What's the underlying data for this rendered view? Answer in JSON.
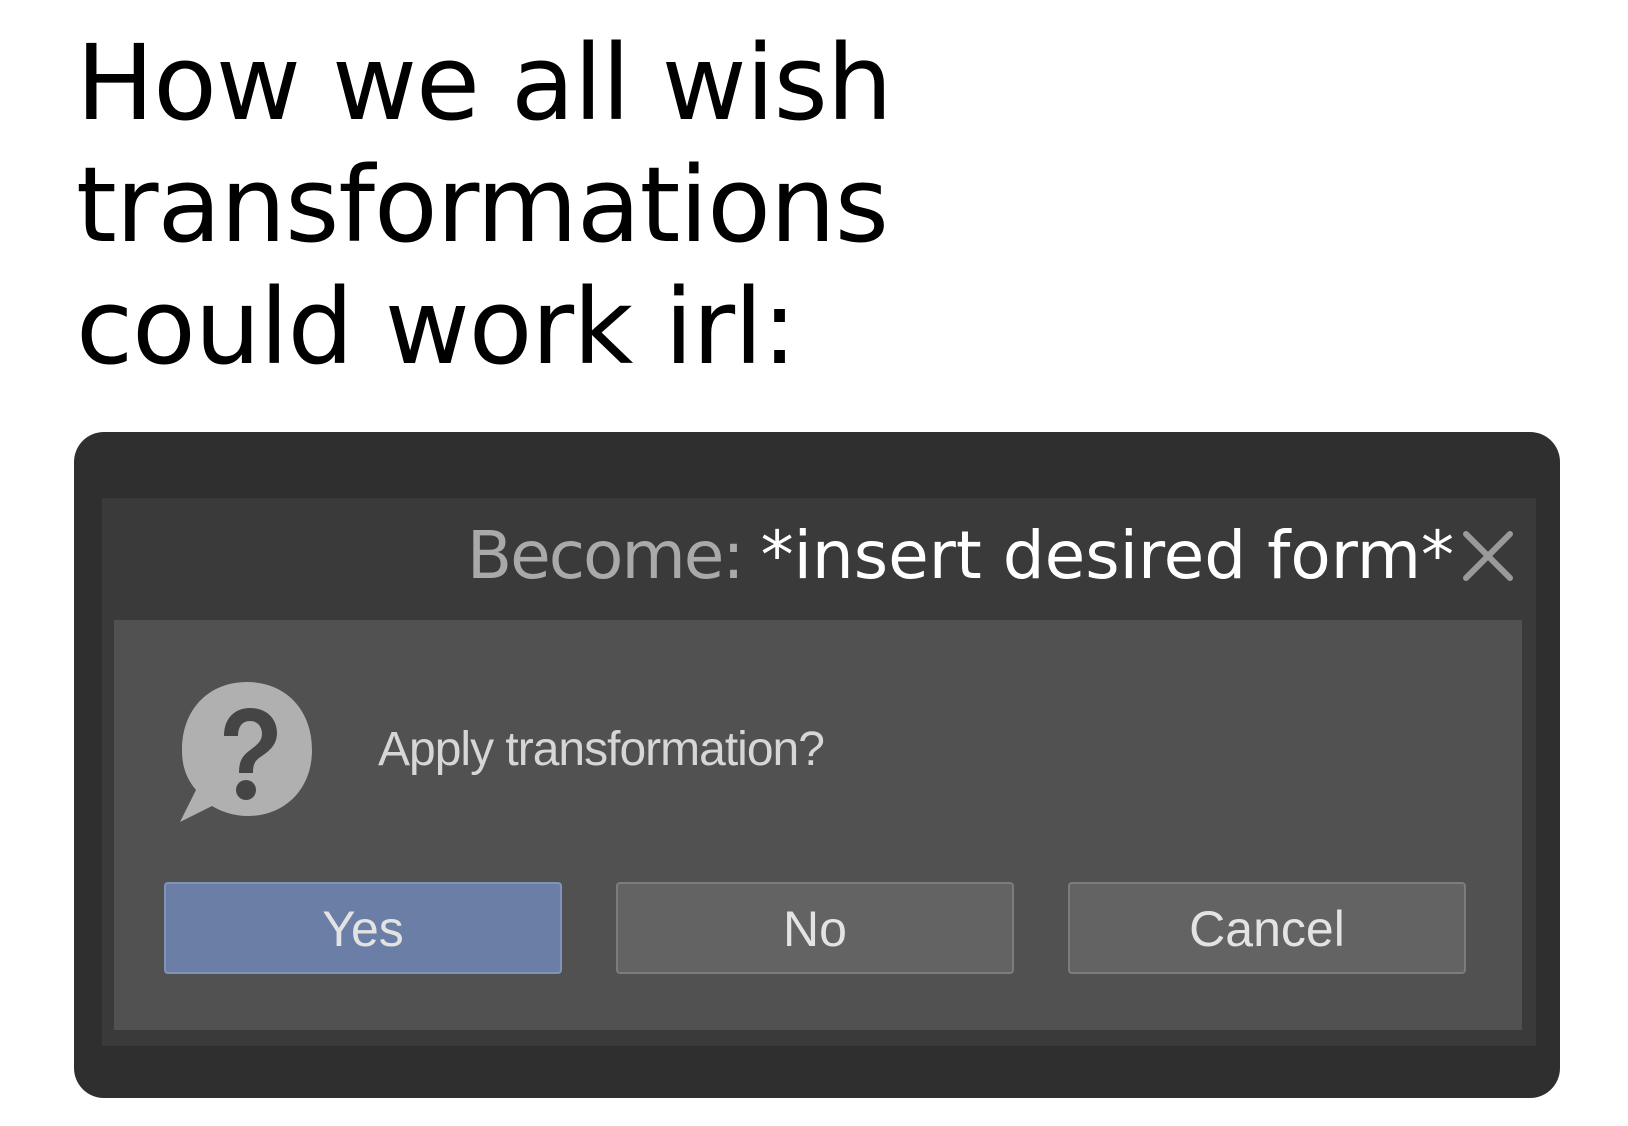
{
  "caption": {
    "lines": [
      "How we all wish",
      "transformations",
      "could work irl:"
    ]
  },
  "dialog": {
    "title_prefix": "Become:",
    "title_form": "*insert desired form*",
    "close_icon": "close-icon",
    "question_icon": "question-bubble-icon",
    "message": "Apply transformation?",
    "buttons": {
      "yes": "Yes",
      "no": "No",
      "cancel": "Cancel"
    }
  },
  "colors": {
    "frame": "#2f2f2f",
    "dialog": "#3a3a3a",
    "content": "#515151",
    "primary_button": "#6a7ea6",
    "secondary_button": "#636363"
  }
}
